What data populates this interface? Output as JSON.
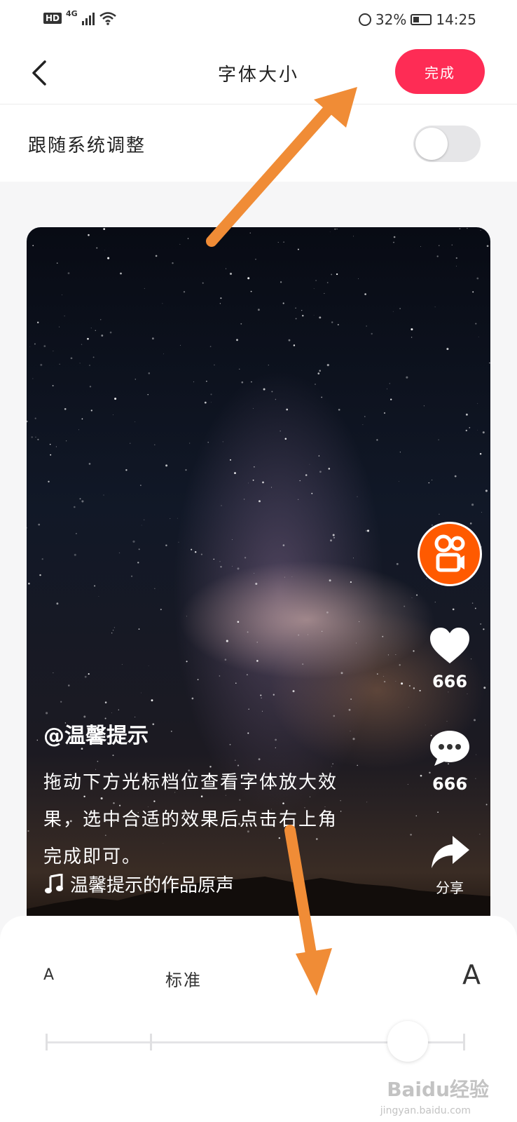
{
  "status_bar": {
    "hd": "HD",
    "network": "4G",
    "battery": "32%",
    "time": "14:25"
  },
  "header": {
    "title": "字体大小",
    "done_label": "完成"
  },
  "follow_system": {
    "label": "跟随系统调整",
    "enabled": false
  },
  "preview": {
    "author": "@温馨提示",
    "caption": "拖动下方光标档位查看字体放大效果，选中合适的效果后点击右上角完成即可。",
    "music": "温馨提示的作品原声",
    "like_count": "666",
    "comment_count": "666",
    "share_label": "分享"
  },
  "font_slider": {
    "small_label": "A",
    "standard_label": "标准",
    "large_label": "A",
    "levels": 5,
    "selected_level": 4
  },
  "watermark": {
    "text": "Baidu经验",
    "sub": "jingyan.baidu.com"
  },
  "colors": {
    "accent": "#fe2c55",
    "annotation_arrow": "#f08c36",
    "avatar": "#ff5a00"
  }
}
